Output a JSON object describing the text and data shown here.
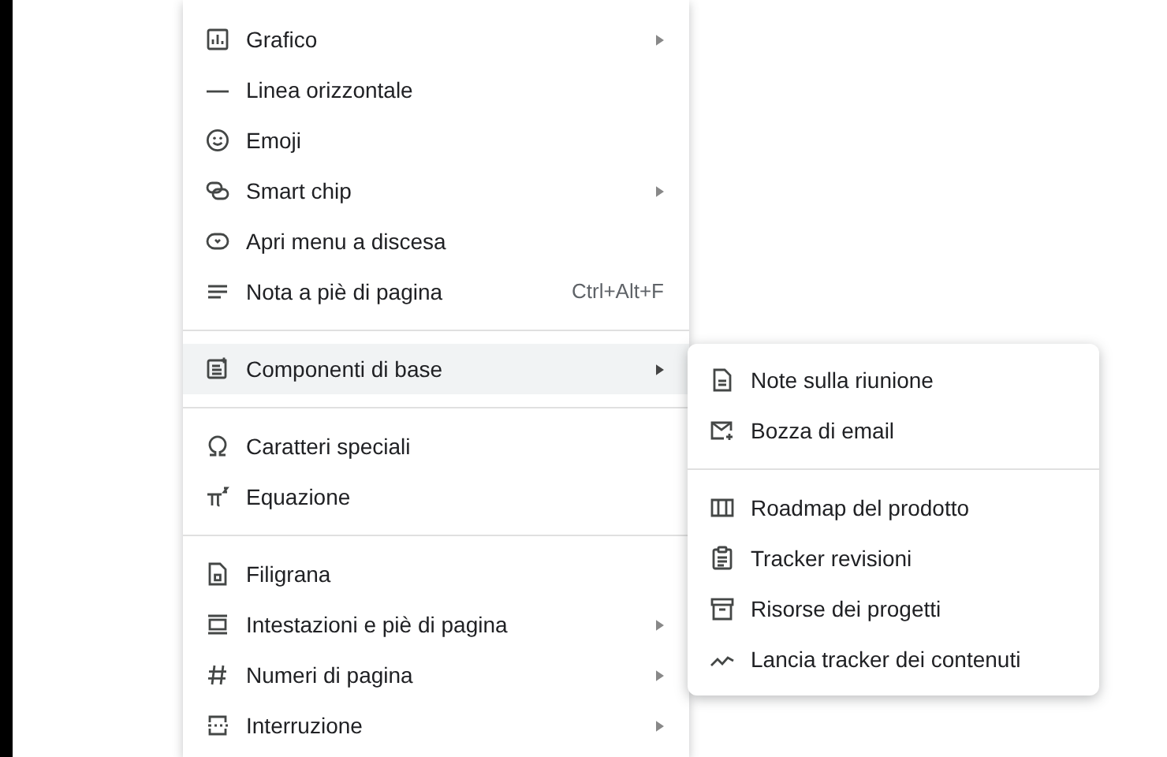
{
  "insert_menu": {
    "sections": [
      [
        {
          "label": "Grafico",
          "has_submenu": true,
          "selected": false
        },
        {
          "label": "Linea orizzontale",
          "has_submenu": false,
          "selected": false
        },
        {
          "label": "Emoji",
          "has_submenu": false,
          "selected": false
        },
        {
          "label": "Smart chip",
          "has_submenu": true,
          "selected": false
        },
        {
          "label": "Apri menu a discesa",
          "has_submenu": false,
          "selected": false
        },
        {
          "label": "Nota a piè di pagina",
          "has_submenu": false,
          "selected": false,
          "shortcut": "Ctrl+Alt+F"
        }
      ],
      [
        {
          "label": "Componenti di base",
          "has_submenu": true,
          "selected": true
        }
      ],
      [
        {
          "label": "Caratteri speciali",
          "has_submenu": false,
          "selected": false
        },
        {
          "label": "Equazione",
          "has_submenu": false,
          "selected": false
        }
      ],
      [
        {
          "label": "Filigrana",
          "has_submenu": false,
          "selected": false
        },
        {
          "label": "Intestazioni e piè di pagina",
          "has_submenu": true,
          "selected": false
        },
        {
          "label": "Numeri di pagina",
          "has_submenu": true,
          "selected": false
        },
        {
          "label": "Interruzione",
          "has_submenu": true,
          "selected": false
        }
      ]
    ]
  },
  "submenu": {
    "sections": [
      [
        {
          "label": "Note sulla riunione"
        },
        {
          "label": "Bozza di email"
        }
      ],
      [
        {
          "label": "Roadmap del prodotto"
        },
        {
          "label": "Tracker revisioni"
        },
        {
          "label": "Risorse dei progetti"
        },
        {
          "label": "Lancia tracker dei contenuti"
        }
      ]
    ]
  }
}
